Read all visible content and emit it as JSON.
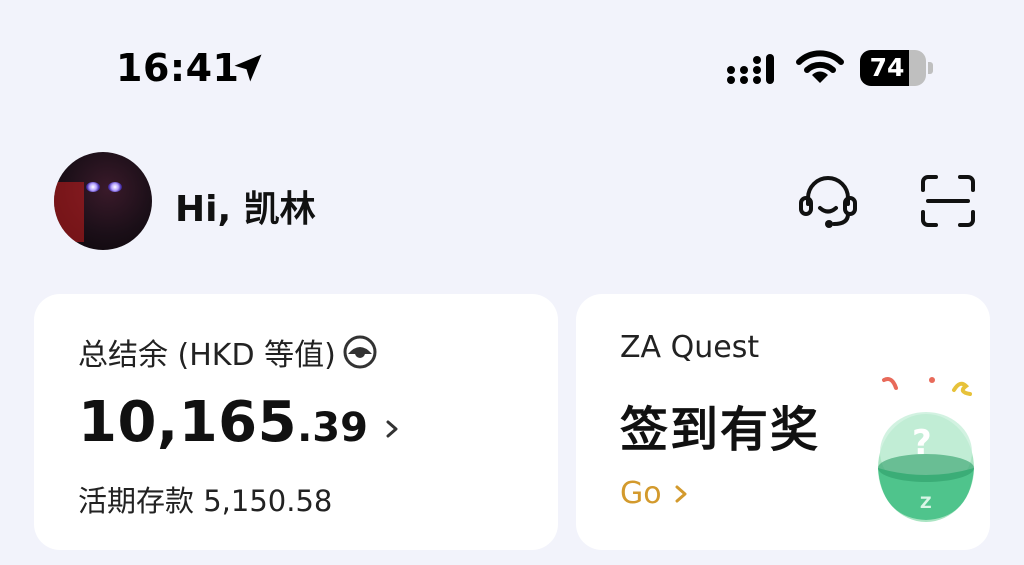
{
  "status_bar": {
    "time": "16:41",
    "battery": "74",
    "battery_level": 0.74
  },
  "header": {
    "greeting": "Hi, 凯林",
    "icons": [
      "headset-icon",
      "scan-icon"
    ]
  },
  "balance_card": {
    "label": "总结余 (HKD 等值)",
    "amount_integer": "10,165",
    "amount_decimal": ".39",
    "savings_label": "活期存款",
    "savings_amount": "5,150.58"
  },
  "quest_card": {
    "title": "ZA Quest",
    "subtitle": "签到有奖",
    "link_label": "Go"
  },
  "colors": {
    "background": "#f2f3fb",
    "card": "#ffffff",
    "accent_gold": "#d39a2d"
  }
}
